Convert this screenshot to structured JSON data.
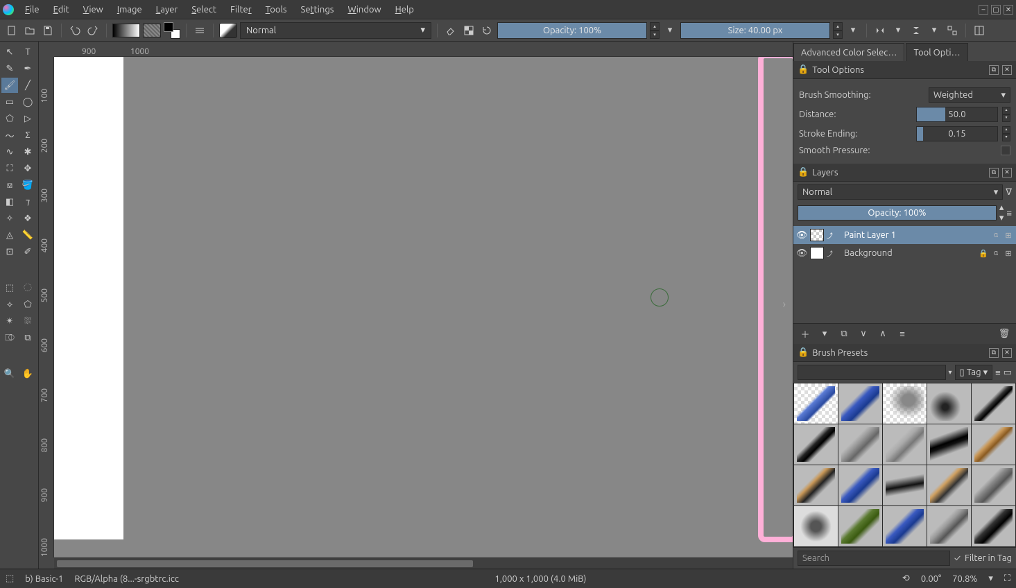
{
  "menu": {
    "items": [
      "File",
      "Edit",
      "View",
      "Image",
      "Layer",
      "Select",
      "Filter",
      "Tools",
      "Settings",
      "Window",
      "Help"
    ]
  },
  "toolbar": {
    "blend_mode": "Normal",
    "opacity_label": "Opacity: 100%",
    "size_label": "Size: 40.00 px"
  },
  "ruler_h": {
    "ticks": [
      {
        "v": "900",
        "p": 40
      },
      {
        "v": "1000",
        "p": 110
      }
    ]
  },
  "ruler_v": {
    "ticks": [
      {
        "v": "100",
        "p": 46
      },
      {
        "v": "200",
        "p": 118
      },
      {
        "v": "300",
        "p": 190
      },
      {
        "v": "400",
        "p": 262
      },
      {
        "v": "500",
        "p": 334
      },
      {
        "v": "600",
        "p": 406
      },
      {
        "v": "700",
        "p": 478
      },
      {
        "v": "800",
        "p": 550
      },
      {
        "v": "900",
        "p": 622
      },
      {
        "v": "1000",
        "p": 694
      }
    ]
  },
  "tabs": {
    "left": "Advanced Color Selec…",
    "right": "Tool Opti…"
  },
  "tool_options": {
    "title": "Tool Options",
    "smoothing_label": "Brush Smoothing:",
    "smoothing_value": "Weighted",
    "distance_label": "Distance:",
    "distance_value": "50.0",
    "stroke_label": "Stroke Ending:",
    "stroke_value": "0.15",
    "pressure_label": "Smooth Pressure:"
  },
  "layers": {
    "title": "Layers",
    "blend": "Normal",
    "opacity_label": "Opacity:  100%",
    "items": [
      {
        "name": "Paint Layer 1",
        "selected": true,
        "checker": true,
        "locked": false
      },
      {
        "name": "Background",
        "selected": false,
        "checker": false,
        "locked": true
      }
    ]
  },
  "presets": {
    "title": "Brush Presets",
    "tag_label": "Tag",
    "search_placeholder": "Search",
    "filter_label": "Filter in Tag"
  },
  "status": {
    "brush": "b) Basic-1",
    "colorspace": "RGB/Alpha (8...-srgbtrc.icc",
    "dims": "1,000 x 1,000 (4.0 MiB)",
    "angle": "0.00°",
    "zoom": "70.8%"
  }
}
